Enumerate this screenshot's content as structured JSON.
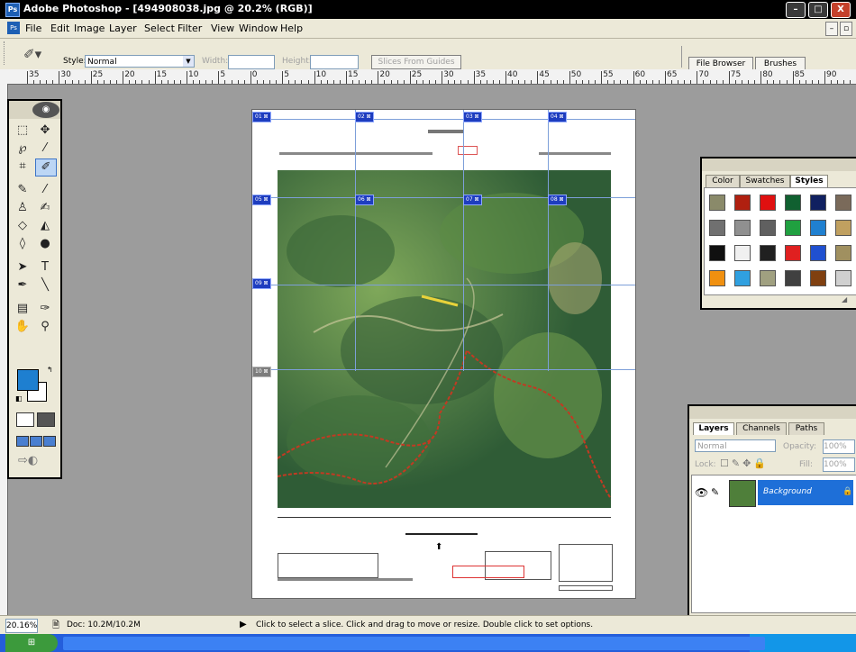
{
  "window": {
    "title": "Adobe Photoshop - [494908038.jpg @ 20.2% (RGB)]",
    "app_icon": "photoshop-icon",
    "buttons": {
      "minimize": "–",
      "maximize": "□",
      "close": "X"
    }
  },
  "menu": {
    "items": [
      "File",
      "Edit",
      "Image",
      "Layer",
      "Select",
      "Filter",
      "View",
      "Window",
      "Help"
    ],
    "right": [
      "–",
      "▫"
    ]
  },
  "options": {
    "style_label": "Style:",
    "style_value": "Normal",
    "width_label": "Width:",
    "height_label": "Height:",
    "slices_button": "Slices From Guides",
    "tabs": [
      "File Browser",
      "Brushes"
    ]
  },
  "ruler": {
    "labels": [
      "35",
      "30",
      "25",
      "20",
      "15",
      "10",
      "5",
      "0",
      "5",
      "10",
      "15",
      "20",
      "25",
      "30",
      "35",
      "40",
      "45",
      "50",
      "55",
      "60",
      "65",
      "70",
      "75",
      "80",
      "85",
      "90"
    ]
  },
  "document": {
    "slices": [
      {
        "num": "01",
        "tag": "01 ⊠"
      },
      {
        "num": "02",
        "tag": "02 ⊠"
      },
      {
        "num": "03",
        "tag": "03 ⊠"
      },
      {
        "num": "04",
        "tag": "04 ⊠"
      },
      {
        "num": "05",
        "tag": "05 ⊠"
      },
      {
        "num": "06",
        "tag": "06 ⊠"
      },
      {
        "num": "07",
        "tag": "07 ⊠"
      },
      {
        "num": "08",
        "tag": "08 ⊠"
      },
      {
        "num": "09",
        "tag": "09 ⊠"
      },
      {
        "num": "10",
        "tag": "10 ⊠"
      }
    ]
  },
  "styles_panel": {
    "tabs": [
      "Color",
      "Swatches",
      "Styles"
    ],
    "active_tab": "Styles",
    "swatch_colors": [
      "#8a8a6a",
      "#b02010",
      "#e01010",
      "#106030",
      "#102060",
      "#7a6a5a",
      "#707070",
      "#909090",
      "#606060",
      "#20a040",
      "#2080d0",
      "#c0a060",
      "#101010",
      "#f0f0f0",
      "#202020",
      "#e02020",
      "#2050d0",
      "#a09060",
      "#f09010",
      "#30a0e0",
      "#a0a080",
      "#404040",
      "#804010",
      "#d0d0d0"
    ]
  },
  "layers_panel": {
    "tabs": [
      "Layers",
      "Channels",
      "Paths"
    ],
    "mode": "Normal",
    "opacity_label": "Opacity:",
    "opacity_value": "100%",
    "lock_label": "Lock:",
    "fill_label": "Fill:",
    "fill_value": "100%",
    "layer_name": "Background"
  },
  "status": {
    "zoom": "20.16%",
    "doc_info": "Doc: 10.2M/10.2M",
    "hint": "Click to select a slice. Click and drag to move or resize. Double click to set options."
  },
  "taskbar": {
    "tasks": [
      "",
      "",
      "",
      "",
      "",
      "",
      "",
      "",
      "",
      "",
      "",
      "",
      ""
    ]
  },
  "colors": {
    "foreground": "#1e7fd0",
    "background": "#ffffff",
    "slice_tag": "#1e3dbf",
    "guide": "#7d9fd9"
  }
}
